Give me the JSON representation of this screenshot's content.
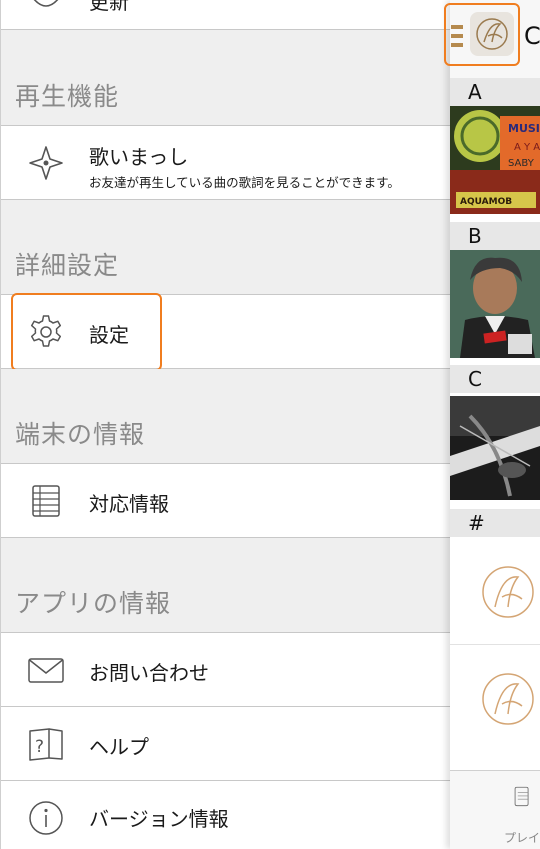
{
  "drawer": {
    "top_partial_label": "更新",
    "sections": {
      "playback": "再生機能",
      "advanced": "詳細設定",
      "device": "端末の情報",
      "app": "アプリの情報"
    },
    "items": {
      "utaimashi": {
        "label": "歌いまっし",
        "sub": "お友達が再生している曲の歌詞を見ることができます。"
      },
      "settings": {
        "label": "設定"
      },
      "supported": {
        "label": "対応情報"
      },
      "contact": {
        "label": "お問い合わせ"
      },
      "help": {
        "label": "ヘルプ"
      },
      "version": {
        "label": "バージョン情報"
      }
    }
  },
  "panel": {
    "top_letter": "C",
    "sections": [
      "A",
      "B",
      "C",
      "#"
    ],
    "tab_label": "プレイ",
    "album_art": {
      "a": "MUSIC A Y A SABY AQUAMOB"
    }
  },
  "colors": {
    "highlight": "#f07d1f",
    "header_bg": "#efefef",
    "gold": "#c9944a"
  }
}
